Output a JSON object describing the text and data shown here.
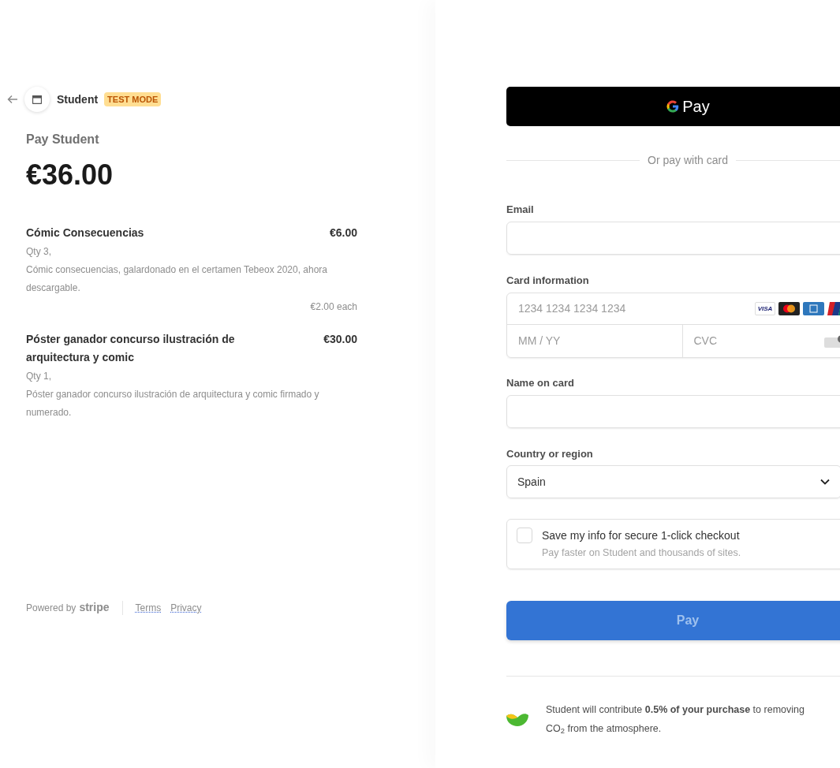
{
  "header": {
    "merchant": "Student",
    "badge": "TEST MODE"
  },
  "summary": {
    "label": "Pay Student",
    "total": "€36.00"
  },
  "items": [
    {
      "name": "Cómic Consecuencias",
      "price": "€6.00",
      "qty": "Qty 3,",
      "description": "Cómic consecuencias, galardonado en el certamen Tebeox 2020, ahora descargable.",
      "unit_price": "€2.00 each"
    },
    {
      "name": "Póster ganador concurso ilustración de arquitectura y comic",
      "price": "€30.00",
      "qty": "Qty 1,",
      "description": "Póster ganador concurso ilustración de arquitectura y comic firmado y numerado."
    }
  ],
  "footer": {
    "powered_by": "Powered by",
    "brand": "stripe",
    "links": [
      "Terms",
      "Privacy"
    ]
  },
  "gpay_button": {
    "label": "Pay"
  },
  "divider_text": "Or pay with card",
  "email": {
    "label": "Email"
  },
  "card": {
    "label": "Card information",
    "number_placeholder": "1234 1234 1234 1234",
    "expiry_placeholder": "MM / YY",
    "cvc_placeholder": "CVC",
    "visa": "VISA"
  },
  "name_on_card": {
    "label": "Name on card"
  },
  "country": {
    "label": "Country or region",
    "value": "Spain"
  },
  "save_info": {
    "checked": false,
    "title": "Save my info for secure 1-click checkout",
    "subtitle": "Pay faster on Student and thousands of sites."
  },
  "pay_button": {
    "label": "Pay",
    "disabled": true
  },
  "climate": {
    "text": "Student will contribute **0.5% of your purchase** to removing CO$_{2}$ from the atmosphere."
  }
}
